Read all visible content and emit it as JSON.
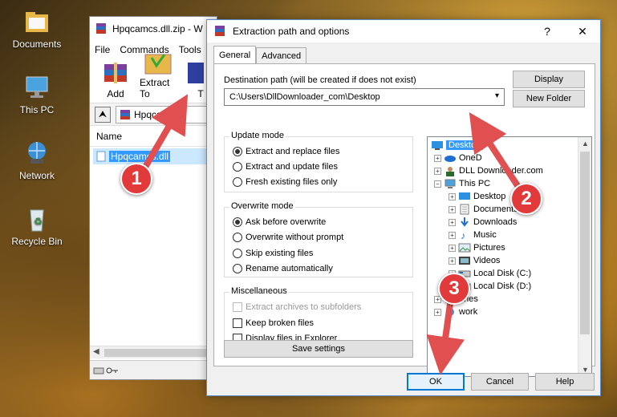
{
  "desktop": {
    "icons": [
      {
        "label": "Documents"
      },
      {
        "label": "This PC"
      },
      {
        "label": "Network"
      },
      {
        "label": "Recycle Bin"
      }
    ]
  },
  "main_window": {
    "title": "Hpqcamcs.dll.zip - W",
    "menu": [
      "File",
      "Commands",
      "Tools"
    ],
    "toolbar": {
      "add": "Add",
      "extract_to": "Extract To",
      "partial": "T"
    },
    "path": "Hpqcamcs",
    "column_name": "Name",
    "file": "Hpqcamcs.dll"
  },
  "dialog": {
    "title": "Extraction path and options",
    "help": "?",
    "close": "✕",
    "tabs": [
      "General",
      "Advanced"
    ],
    "destination_label": "Destination path (will be created if does not exist)",
    "destination_value": "C:\\Users\\DllDownloader_com\\Desktop",
    "display_button": "Display",
    "new_folder_button": "New Folder",
    "update_mode": {
      "title": "Update mode",
      "options": [
        "Extract and replace files",
        "Extract and update files",
        "Fresh existing files only"
      ],
      "selected": 0
    },
    "overwrite_mode": {
      "title": "Overwrite mode",
      "options": [
        "Ask before overwrite",
        "Overwrite without prompt",
        "Skip existing files",
        "Rename automatically"
      ],
      "selected": 0
    },
    "misc": {
      "title": "Miscellaneous",
      "options": [
        "Extract archives to subfolders",
        "Keep broken files",
        "Display files in Explorer"
      ]
    },
    "save_settings": "Save settings",
    "ok": "OK",
    "cancel": "Cancel",
    "help_button": "Help",
    "tree": {
      "desktop": "Desktop",
      "onedrive": "OneD",
      "dll": "DLL Downloader.com",
      "thispc": "This PC",
      "children": [
        "Desktop",
        "Documents",
        "Downloads",
        "Music",
        "Pictures",
        "Videos",
        "Local Disk (C:)",
        "Local Disk (D:)"
      ],
      "libraries": "aries",
      "network": "work"
    }
  },
  "annotations": [
    "1",
    "2",
    "3"
  ],
  "colors": {
    "accent": "#3399ff",
    "badge": "#e23a3a",
    "arrow": "#e05050"
  }
}
